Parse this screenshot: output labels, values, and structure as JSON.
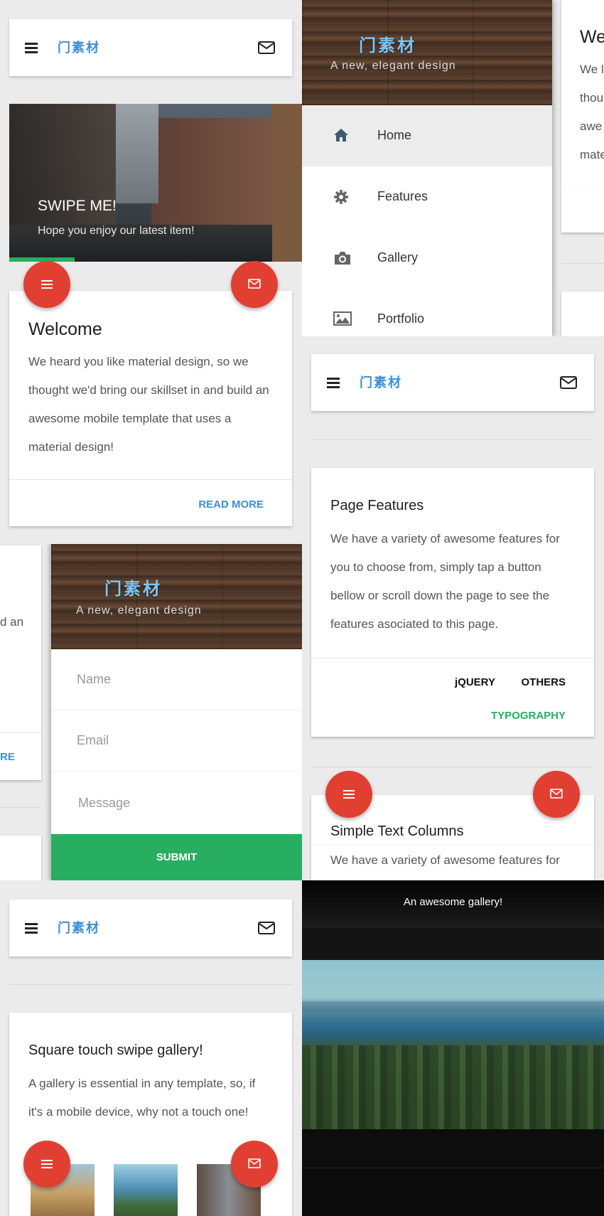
{
  "brand": {
    "logo": "门素材",
    "tagline": "A new, elegant design",
    "accent": "#3a8fd6",
    "fab_color": "#e13f32",
    "green": "#27ae60"
  },
  "slider": {
    "title": "SWIPE ME!",
    "subtitle": "Hope you enjoy our latest item!"
  },
  "welcome": {
    "title": "Welcome",
    "lines": [
      "We heard you like material design, so we",
      "thought we'd bring our skillset in and build an",
      "awesome mobile template that uses a",
      "material design!"
    ],
    "read_more": "READ MORE"
  },
  "peek_top": {
    "title": "We",
    "lines": [
      "We l",
      "thou",
      "awe",
      "mate"
    ]
  },
  "peek_left": {
    "lines": [
      "d an"
    ],
    "link": "RE"
  },
  "nav": {
    "items": [
      {
        "label": "Home",
        "icon": "home-icon",
        "active": true
      },
      {
        "label": "Features",
        "icon": "gear-icon",
        "active": false
      },
      {
        "label": "Gallery",
        "icon": "camera-icon",
        "active": false
      },
      {
        "label": "Portfolio",
        "icon": "image-icon",
        "active": false
      }
    ]
  },
  "contact_form": {
    "name_placeholder": "Name",
    "email_placeholder": "Email",
    "message_placeholder": "Message",
    "submit_label": "SUBMIT"
  },
  "features": {
    "title": "Page Features",
    "lines": [
      "We have a variety of awesome features for",
      "you to choose from, simply tap a button",
      "bellow or scroll down the page to see the",
      "features asociated to this page."
    ],
    "btn_jquery": "jQUERY",
    "btn_others": "OTHERS",
    "btn_typography": "TYPOGRAPHY"
  },
  "columns": {
    "title": "Simple Text Columns",
    "line": "We have a variety of awesome features for"
  },
  "gallery_card": {
    "title": "Square touch swipe gallery!",
    "lines": [
      "A gallery is essential in any template, so, if",
      "it's a mobile device, why not a touch one!"
    ]
  },
  "lightbox": {
    "caption": "An awesome gallery!"
  }
}
